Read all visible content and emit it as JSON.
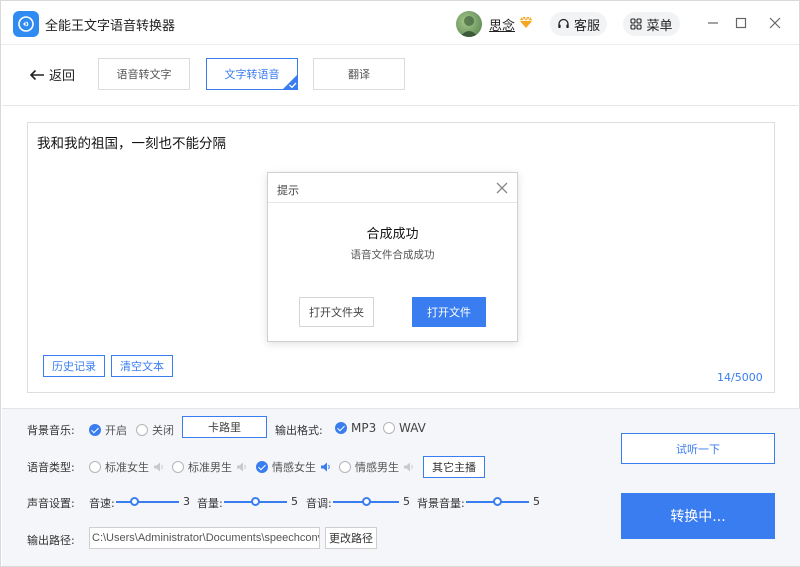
{
  "app": {
    "title": "全能王文字语音转换器",
    "accent": "#3a7df0"
  },
  "header": {
    "username": "思念",
    "service_label": "客服",
    "menu_label": "菜单"
  },
  "nav": {
    "back_label": "返回",
    "tabs": [
      {
        "label": "语音转文字",
        "active": false
      },
      {
        "label": "文字转语音",
        "active": true
      },
      {
        "label": "翻译",
        "active": false
      }
    ]
  },
  "editor": {
    "text": "我和我的祖国，一刻也不能分隔",
    "history_label": "历史记录",
    "clear_label": "清空文本",
    "char_count": "14/5000"
  },
  "dialog": {
    "title": "提示",
    "heading": "合成成功",
    "message": "语音文件合成成功",
    "open_folder_label": "打开文件夹",
    "open_file_label": "打开文件"
  },
  "settings": {
    "bgm": {
      "label": "背景音乐:",
      "on_label": "开启",
      "off_label": "关闭",
      "selected": "on",
      "track": "卡路里"
    },
    "format": {
      "label": "输出格式:",
      "options": [
        "MP3",
        "WAV"
      ],
      "selected": "MP3"
    },
    "voice": {
      "label": "语音类型:",
      "options": [
        {
          "label": "标准女生",
          "selected": false
        },
        {
          "label": "标准男生",
          "selected": false
        },
        {
          "label": "情感女生",
          "selected": true
        },
        {
          "label": "情感男生",
          "selected": false
        }
      ],
      "other_label": "其它主播"
    },
    "sound": {
      "label": "声音设置:",
      "speed": {
        "label": "音速:",
        "value": 3,
        "min": 0,
        "max": 10
      },
      "volume": {
        "label": "音量:",
        "value": 5,
        "min": 0,
        "max": 10
      },
      "pitch": {
        "label": "音调:",
        "value": 5,
        "min": 0,
        "max": 10
      },
      "bg_volume": {
        "label": "背景音量:",
        "value": 5,
        "min": 0,
        "max": 10
      }
    },
    "output": {
      "label": "输出路径:",
      "path": "C:\\Users\\Administrator\\Documents\\speechconvert",
      "change_label": "更改路径"
    },
    "try_label": "试听一下",
    "convert_label": "转换中..."
  }
}
